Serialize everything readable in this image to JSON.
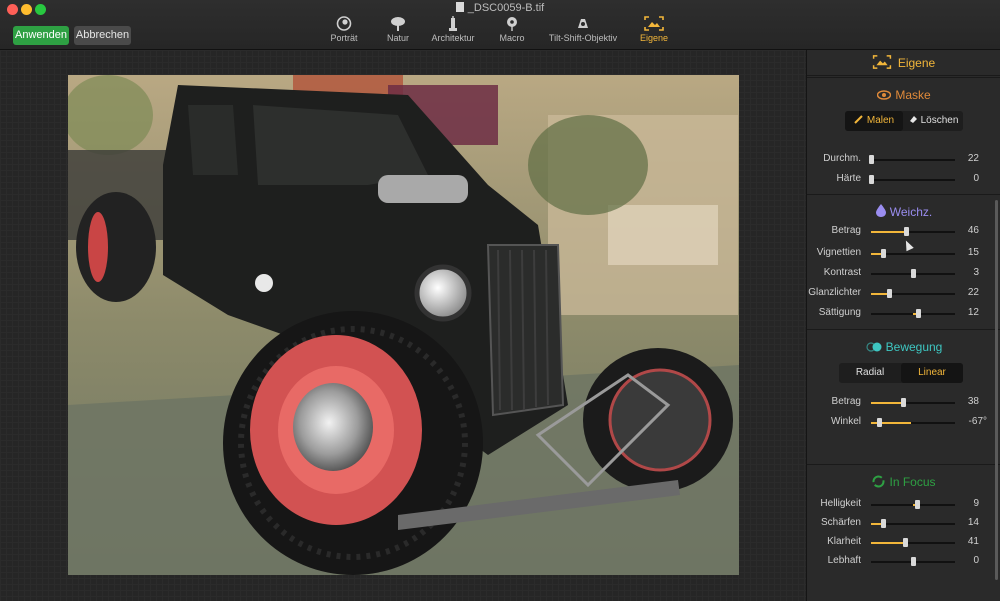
{
  "window": {
    "title": "_DSC0059-B.tif"
  },
  "toolbar": {
    "apply_label": "Anwenden",
    "cancel_label": "Abbrechen"
  },
  "presets": [
    {
      "label": "Porträt",
      "icon": "portrait-icon",
      "active": false
    },
    {
      "label": "Natur",
      "icon": "tree-icon",
      "active": false
    },
    {
      "label": "Architektur",
      "icon": "building-icon",
      "active": false
    },
    {
      "label": "Macro",
      "icon": "flower-icon",
      "active": false
    },
    {
      "label": "Tilt-Shift-Objektiv",
      "icon": "tilt-shift-icon",
      "active": false
    },
    {
      "label": "Eigene",
      "icon": "custom-frame-icon",
      "active": true
    }
  ],
  "panel": {
    "title": "Eigene",
    "maske": {
      "title": "Maske",
      "paint_label": "Malen",
      "erase_label": "Löschen",
      "sliders": [
        {
          "label": "Durchm.",
          "value": "22",
          "level": 0.0
        },
        {
          "label": "Härte",
          "value": "0",
          "level": 0.0
        }
      ]
    },
    "weichz": {
      "title": "Weichz.",
      "sliders": [
        {
          "label": "Betrag",
          "value": "46",
          "level": 0.42
        },
        {
          "label": "Vignettien",
          "value": "15",
          "level": 0.14
        },
        {
          "label": "Kontrast",
          "value": "3",
          "level": 0.5
        },
        {
          "label": "Glanzlichter",
          "value": "22",
          "level": 0.22
        },
        {
          "label": "Sättigung",
          "value": "12",
          "level": 0.56
        }
      ]
    },
    "bewegung": {
      "title": "Bewegung",
      "radial_label": "Radial",
      "linear_label": "Linear",
      "sliders": [
        {
          "label": "Betrag",
          "value": "38",
          "level": 0.38
        },
        {
          "label": "Winkel",
          "value": "-67°",
          "level": 0.1
        }
      ]
    },
    "in_focus": {
      "title": "In Focus",
      "sliders": [
        {
          "label": "Helligkeit",
          "value": "9",
          "level": 0.55
        },
        {
          "label": "Schärfen",
          "value": "14",
          "level": 0.14
        },
        {
          "label": "Klarheit",
          "value": "41",
          "level": 0.41
        },
        {
          "label": "Lebhaft",
          "value": "0",
          "level": 0.5
        }
      ]
    }
  },
  "colors": {
    "accent": "#f2b63a",
    "apply_green": "#2ea043",
    "bewegung": "#3ec7c2",
    "in_focus": "#2ea043",
    "maske": "#e08a3a",
    "weichz": "#9a8df0"
  }
}
